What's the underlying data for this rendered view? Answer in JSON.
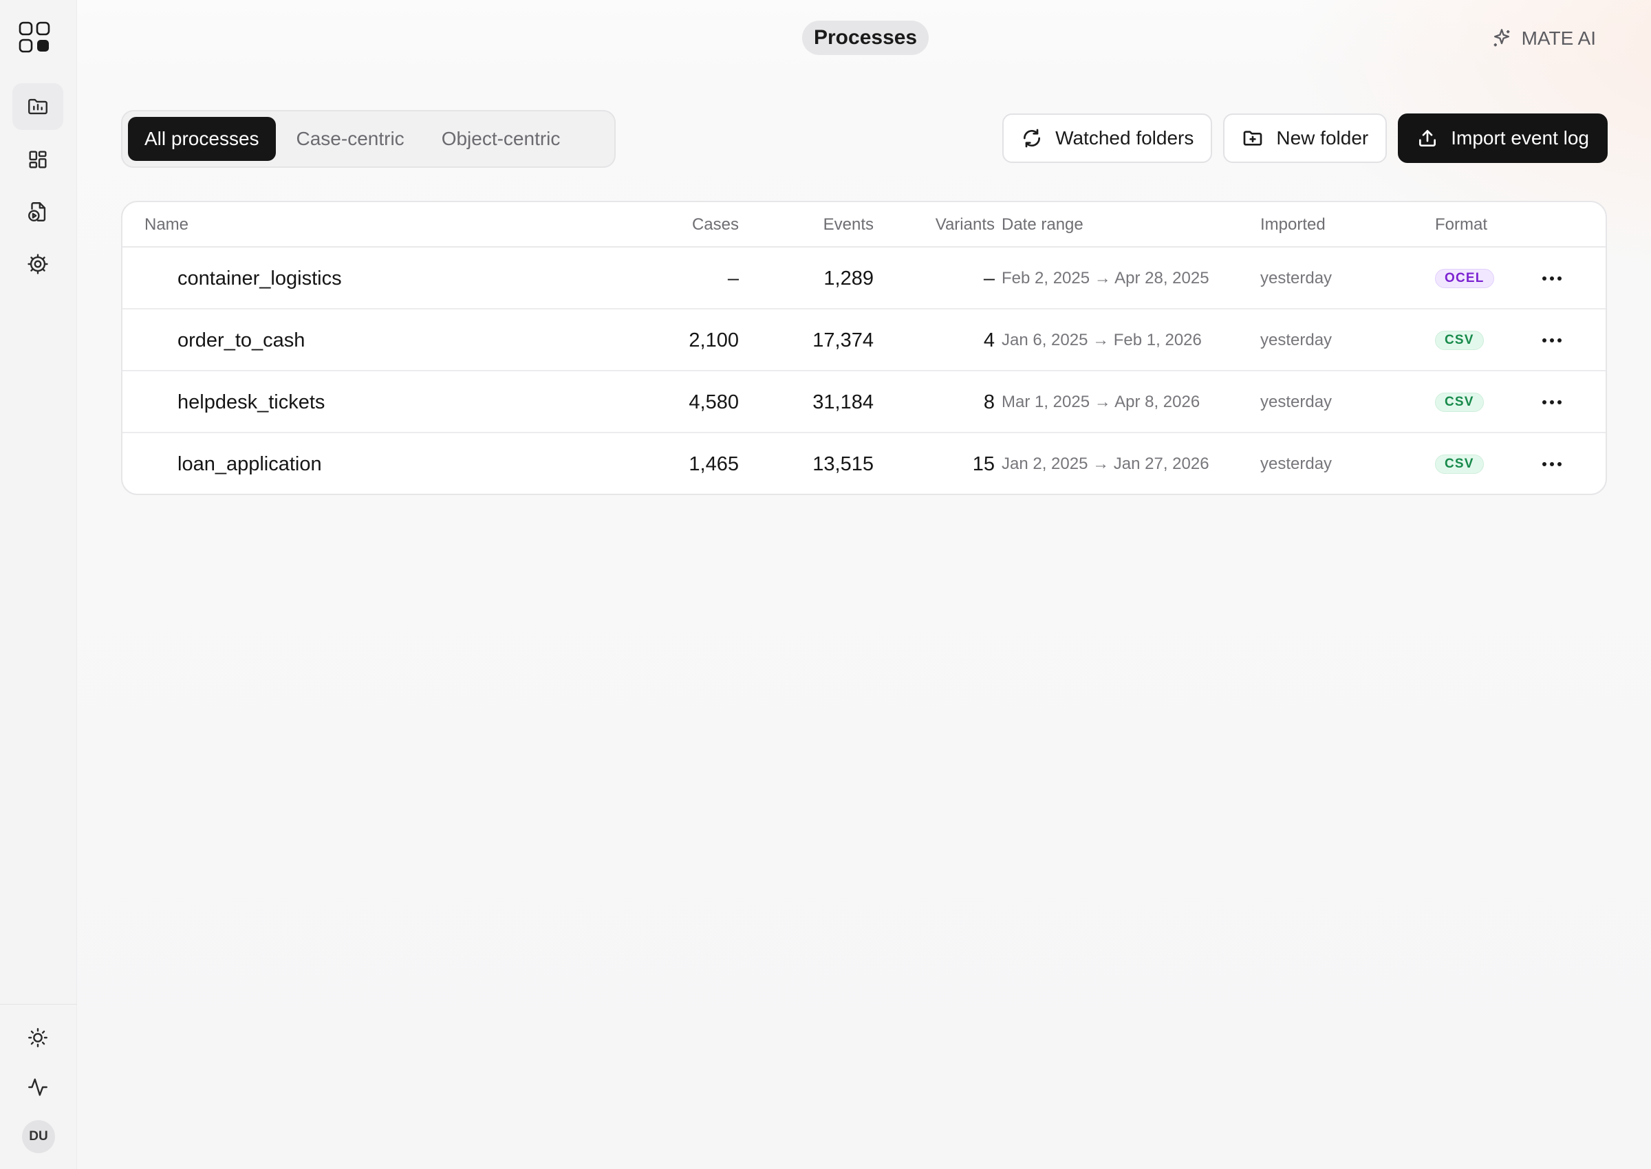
{
  "header": {
    "page_title": "Processes",
    "assistant_label": "MATE AI"
  },
  "sidebar": {
    "items": [
      {
        "name": "processes",
        "icon": "folder-chart-icon",
        "active": true
      },
      {
        "name": "dashboards",
        "icon": "dashboard-grid-icon",
        "active": false
      },
      {
        "name": "reports",
        "icon": "file-play-icon",
        "active": false
      },
      {
        "name": "settings",
        "icon": "gear-icon",
        "active": false
      }
    ],
    "bottom": [
      {
        "name": "theme",
        "icon": "sun-icon"
      },
      {
        "name": "activity",
        "icon": "activity-icon"
      }
    ],
    "avatar_initials": "DU"
  },
  "filters": {
    "tabs": [
      {
        "label": "All processes",
        "active": true
      },
      {
        "label": "Case-centric",
        "active": false
      },
      {
        "label": "Object-centric",
        "active": false
      }
    ]
  },
  "toolbar": {
    "watched_folders_label": "Watched folders",
    "new_folder_label": "New folder",
    "import_label": "Import event log"
  },
  "table": {
    "columns": {
      "name": "Name",
      "cases": "Cases",
      "events": "Events",
      "variants": "Variants",
      "date_range": "Date range",
      "imported": "Imported",
      "format": "Format"
    },
    "rows": [
      {
        "name": "container_logistics",
        "cases": "–",
        "events": "1,289",
        "variants": "–",
        "date_range": "Feb 2, 2025 → Apr 28, 2025",
        "imported": "yesterday",
        "format": "OCEL"
      },
      {
        "name": "order_to_cash",
        "cases": "2,100",
        "events": "17,374",
        "variants": "4",
        "date_range": "Jan 6, 2025 → Feb 1, 2026",
        "imported": "yesterday",
        "format": "CSV"
      },
      {
        "name": "helpdesk_tickets",
        "cases": "4,580",
        "events": "31,184",
        "variants": "8",
        "date_range": "Mar 1, 2025 → Apr 8, 2026",
        "imported": "yesterday",
        "format": "CSV"
      },
      {
        "name": "loan_application",
        "cases": "1,465",
        "events": "13,515",
        "variants": "15",
        "date_range": "Jan 2, 2025 → Jan 27, 2026",
        "imported": "yesterday",
        "format": "CSV"
      }
    ]
  },
  "colors": {
    "primary_dark": "#141414",
    "ocel_badge": "#7c22d1",
    "csv_badge": "#178a4b"
  }
}
